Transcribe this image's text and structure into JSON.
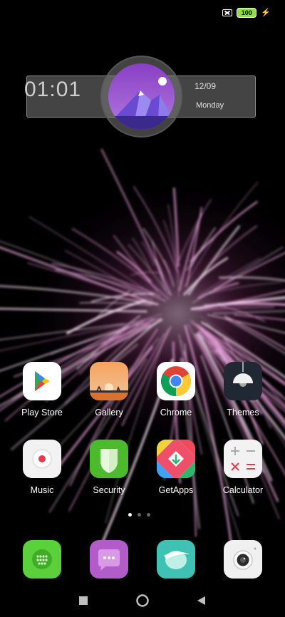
{
  "status_bar": {
    "battery_level": "100",
    "icons": [
      "no-sim-icon",
      "battery-icon",
      "charging-bolt-icon"
    ]
  },
  "clock_widget": {
    "time": "01:01",
    "date": "12/09",
    "weekday": "Monday"
  },
  "apps": [
    {
      "label": "Play Store",
      "icon": "play-store-icon"
    },
    {
      "label": "Gallery",
      "icon": "gallery-icon"
    },
    {
      "label": "Chrome",
      "icon": "chrome-icon"
    },
    {
      "label": "Themes",
      "icon": "themes-icon"
    },
    {
      "label": "Music",
      "icon": "music-icon"
    },
    {
      "label": "Security",
      "icon": "security-icon"
    },
    {
      "label": "GetApps",
      "icon": "getapps-icon"
    },
    {
      "label": "Calculator",
      "icon": "calculator-icon"
    }
  ],
  "page_indicator": {
    "pages": 3,
    "active": 1
  },
  "dock": [
    {
      "icon": "phone-dialer-icon"
    },
    {
      "icon": "messaging-icon"
    },
    {
      "icon": "browser-icon"
    },
    {
      "icon": "camera-icon"
    }
  ],
  "nav_bar": {
    "buttons": [
      "recents-button",
      "home-button",
      "back-button"
    ]
  },
  "colors": {
    "firework": "#e6a0d8",
    "battery": "#8de23a",
    "security_green": "#4cba2c",
    "dock_purple": "#b25cc9",
    "dock_teal": "#3fc2b4"
  }
}
